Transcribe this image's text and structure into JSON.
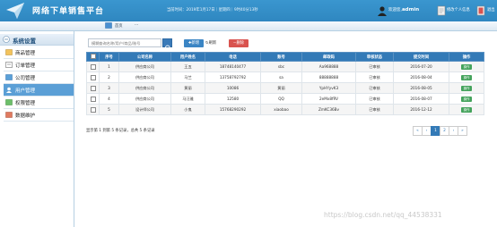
{
  "header": {
    "title": "网络下单销售平台",
    "info": "当前时间：2019年1月17日｜星期四｜9时40分13秒",
    "welcome_prefix": "欢迎您,",
    "username": "admin",
    "edit_label": "修改个人信息",
    "exit_label": "退出"
  },
  "breadcrumb": {
    "home": "首页",
    "separator": "···"
  },
  "sidebar": {
    "title": "系统设置",
    "items": [
      {
        "label": "商品管理",
        "active": false
      },
      {
        "label": "订单管理",
        "active": false
      },
      {
        "label": "公司管理",
        "active": false
      },
      {
        "label": "用户管理",
        "active": true
      },
      {
        "label": "权限管理",
        "active": false
      },
      {
        "label": "数据维护",
        "active": false
      }
    ]
  },
  "toolbar": {
    "search_placeholder": "模糊查询名称/用户/商品/账号",
    "add_label": "新增",
    "refresh_label": "刷新",
    "delete_label": "删除"
  },
  "table": {
    "columns": [
      "",
      "序号",
      "公司名称",
      "用户姓名",
      "电话",
      "账号",
      "邮政码",
      "审核状态",
      "提交时间",
      "操作"
    ],
    "rows": [
      [
        "1",
        "供应商公司",
        "王五",
        "18748140477",
        "sbc",
        "Aa968888",
        "已审核",
        "2016-07-20",
        "操作"
      ],
      [
        "2",
        "供应商公司",
        "马兰",
        "13758792792",
        "sa",
        "88888888",
        "已审核",
        "2016-08-04",
        "操作"
      ],
      [
        "3",
        "供应商公司",
        "黄丽",
        "10086",
        "黄丽",
        "YpHYyvK3",
        "已审核",
        "2016-08-05",
        "操作"
      ],
      [
        "4",
        "供应商公司",
        "马汪雅",
        "12580",
        "QQ",
        "2eMx8fRV",
        "已审核",
        "2016-08-07",
        "操作"
      ],
      [
        "5",
        "设计师公司",
        "小鬼",
        "15768290292",
        "xiaobao",
        "ZmKC36Bv",
        "已审核",
        "2016-12-12",
        "操作"
      ]
    ]
  },
  "footer": {
    "summary": "显示第 1 到第 5 条记录，总共 5 条记录",
    "pages": [
      "«",
      "‹",
      "1",
      "2",
      "›",
      "»"
    ],
    "active_page": "1"
  },
  "watermark": "https://blog.csdn.net/qq_44538331",
  "colors": {
    "header": "#2f87c0",
    "table_header": "#337ab7",
    "add_button": "#3b85c4",
    "delete_button": "#d9534f",
    "operation_button": "#44a35c",
    "active_menu": "#5b9fd6"
  }
}
